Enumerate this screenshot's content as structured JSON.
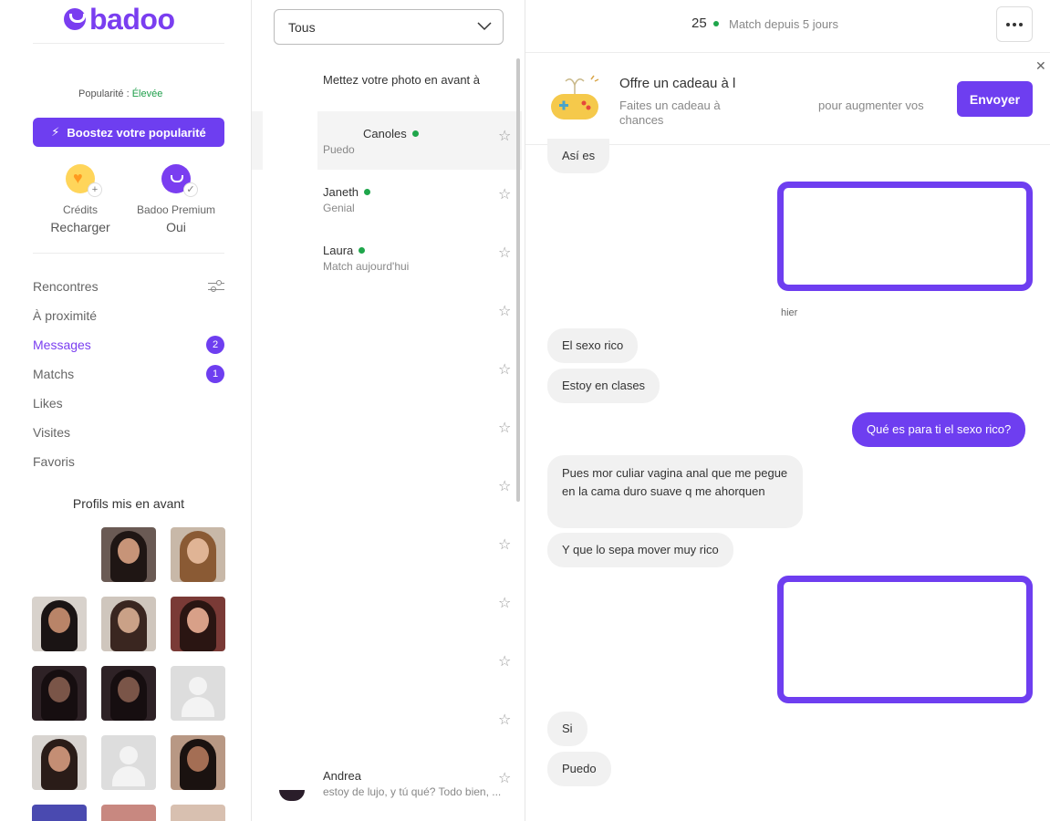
{
  "brand": {
    "name": "badoo"
  },
  "profile": {
    "popularity_label": "Popularité : ",
    "popularity_value": "Élevée"
  },
  "boost": {
    "label": "Boostez votre popularité"
  },
  "features": {
    "credits": {
      "title": "Crédits",
      "action": "Recharger"
    },
    "premium": {
      "title": "Badoo Premium",
      "value": "Oui"
    }
  },
  "nav": [
    {
      "label": "Rencontres",
      "badge": ""
    },
    {
      "label": "À proximité",
      "badge": ""
    },
    {
      "label": "Messages",
      "badge": "2"
    },
    {
      "label": "Matchs",
      "badge": "1"
    },
    {
      "label": "Likes",
      "badge": ""
    },
    {
      "label": "Visites",
      "badge": ""
    },
    {
      "label": "Favoris",
      "badge": ""
    }
  ],
  "featured": {
    "title": "Profils mis en avant"
  },
  "convlist": {
    "filter": "Tous",
    "promo": "Mettez votre photo en avant à",
    "conversations": [
      {
        "name": "Canoles",
        "preview": "Puedo",
        "online": true
      },
      {
        "name": "Janeth",
        "preview": "Genial",
        "online": true
      },
      {
        "name": "Laura",
        "preview": "Match aujourd'hui",
        "online": true
      },
      {
        "name": "Andrea",
        "preview": "estoy de lujo, y tú qué? Todo bien, ...",
        "online": false
      }
    ]
  },
  "chat": {
    "age": "25",
    "match_since": "Match depuis 5 jours",
    "gift": {
      "title": "Offre un cadeau à l",
      "subtitle": "Faites un cadeau à chances",
      "subtitle_right": "pour augmenter vos",
      "send": "Envoyer"
    },
    "day_label": "hier",
    "messages": [
      "Así es",
      "El sexo rico",
      "Estoy en clases",
      "Qué es para ti el sexo rico?",
      "Pues mor culiar vagina anal que me pegue en la cama duro suave q me ahorquen",
      "Y que lo sepa mover muy rico",
      "Si",
      "Puedo"
    ]
  },
  "colors": {
    "accent": "#6e3ef0",
    "online": "#1fa64b"
  },
  "icons": [
    "bolt-icon",
    "heart-icon",
    "premium-icon",
    "filter-icon",
    "chevron-down-icon",
    "star-icon",
    "more-icon",
    "close-icon",
    "gamepad-icon"
  ]
}
